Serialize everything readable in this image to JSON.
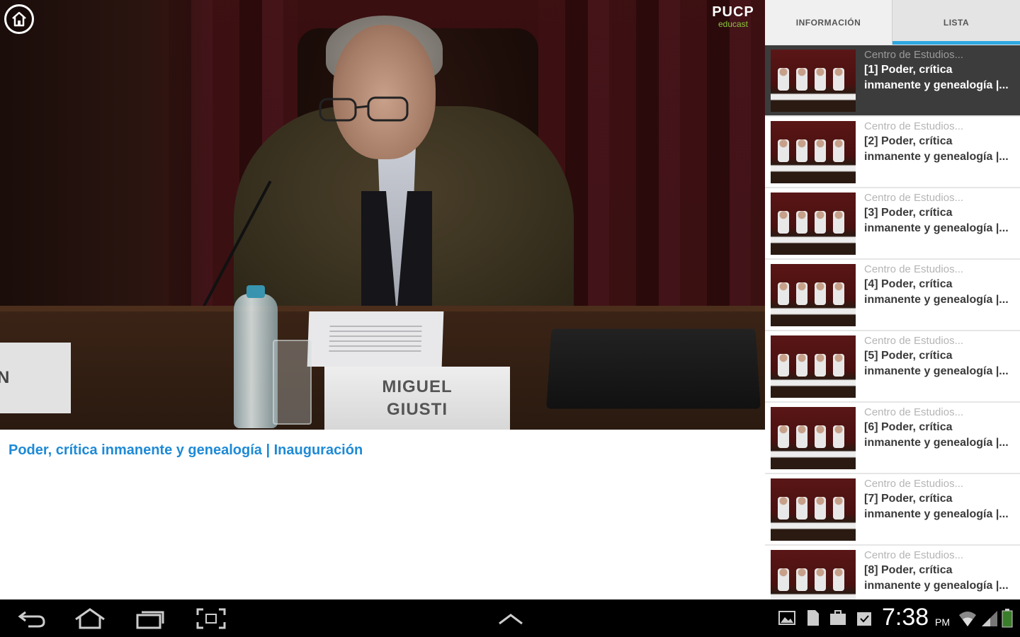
{
  "video": {
    "nameplate_main": [
      "MIGUEL",
      "GIUSTI"
    ],
    "nameplate_left": "N",
    "logo": {
      "line1": "PUCP",
      "line2": "educast"
    }
  },
  "info": {
    "title": "Poder, crítica inmanente y genealogía | Inauguración"
  },
  "tabs": [
    {
      "label": "INFORMACIÓN",
      "active": false
    },
    {
      "label": "LISTA",
      "active": true
    }
  ],
  "playlist": [
    {
      "source": "Centro de Estudios...",
      "line1": "[1] Poder, crítica",
      "line2": "inmanente y genealogía |...",
      "selected": true
    },
    {
      "source": "Centro de Estudios...",
      "line1": "[2] Poder, crítica",
      "line2": "inmanente y genealogía |...",
      "selected": false
    },
    {
      "source": "Centro de Estudios...",
      "line1": "[3] Poder, crítica",
      "line2": "inmanente y genealogía |...",
      "selected": false
    },
    {
      "source": "Centro de Estudios...",
      "line1": "[4] Poder, crítica",
      "line2": "inmanente y genealogía |...",
      "selected": false
    },
    {
      "source": "Centro de Estudios...",
      "line1": "[5] Poder, crítica",
      "line2": "inmanente y genealogía |...",
      "selected": false
    },
    {
      "source": "Centro de Estudios...",
      "line1": "[6] Poder, crítica",
      "line2": "inmanente y genealogía |...",
      "selected": false
    },
    {
      "source": "Centro de Estudios...",
      "line1": "[7] Poder, crítica",
      "line2": "inmanente y genealogía |...",
      "selected": false
    },
    {
      "source": "Centro de Estudios...",
      "line1": "[8] Poder, crítica",
      "line2": "inmanente y genealogía |...",
      "selected": false
    }
  ],
  "statusbar": {
    "time": "7:38",
    "ampm": "PM",
    "icons": [
      "gallery-icon",
      "document-icon",
      "briefcase-icon",
      "clipboard-icon",
      "wifi-icon",
      "signal-icon",
      "battery-icon"
    ]
  },
  "navbar": {
    "icons": [
      "back-icon",
      "home-icon",
      "recent-apps-icon",
      "screenshot-icon",
      "up-chevron-icon"
    ]
  },
  "colors": {
    "accent": "#2ea8e0",
    "title_link": "#1e8ad6",
    "selected_item_bg": "#3c3c3c"
  }
}
